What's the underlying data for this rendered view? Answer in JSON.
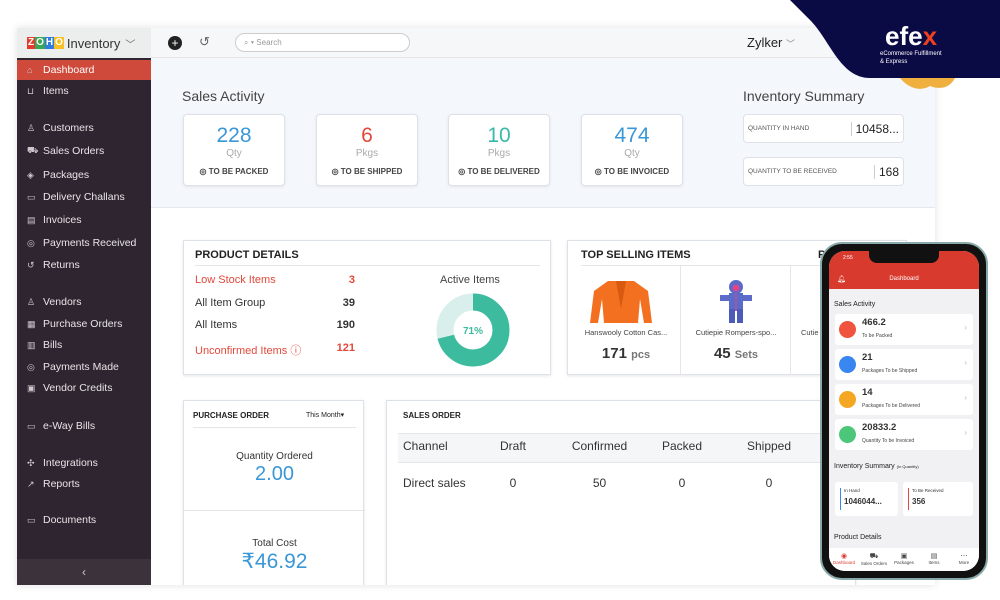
{
  "app": {
    "brand": "Inventory",
    "org": "Zylker",
    "search_placeholder": "Search"
  },
  "sidebar": {
    "items": [
      {
        "label": "Dashboard",
        "icon": "home-icon",
        "active": true
      },
      {
        "label": "Items",
        "icon": "basket-icon"
      },
      {
        "label": "Customers",
        "icon": "user-icon"
      },
      {
        "label": "Sales Orders",
        "icon": "cart-icon"
      },
      {
        "label": "Packages",
        "icon": "package-icon"
      },
      {
        "label": "Delivery Challans",
        "icon": "truck-icon"
      },
      {
        "label": "Invoices",
        "icon": "invoice-icon"
      },
      {
        "label": "Payments Received",
        "icon": "payment-icon"
      },
      {
        "label": "Returns",
        "icon": "return-icon"
      },
      {
        "label": "Vendors",
        "icon": "vendor-icon"
      },
      {
        "label": "Purchase Orders",
        "icon": "purchase-icon"
      },
      {
        "label": "Bills",
        "icon": "bill-icon"
      },
      {
        "label": "Payments Made",
        "icon": "payment-icon"
      },
      {
        "label": "Vendor Credits",
        "icon": "credit-icon"
      },
      {
        "label": "e-Way Bills",
        "icon": "eway-icon"
      },
      {
        "label": "Integrations",
        "icon": "integration-icon"
      },
      {
        "label": "Reports",
        "icon": "report-icon"
      },
      {
        "label": "Documents",
        "icon": "folder-icon"
      }
    ]
  },
  "sales_activity": {
    "title": "Sales Activity",
    "cards": [
      {
        "value": "228",
        "unit": "Qty",
        "label": "TO BE PACKED",
        "color": "#3a97d6"
      },
      {
        "value": "6",
        "unit": "Pkgs",
        "label": "TO BE SHIPPED",
        "color": "#e2493a"
      },
      {
        "value": "10",
        "unit": "Pkgs",
        "label": "TO BE DELIVERED",
        "color": "#3ab8a8"
      },
      {
        "value": "474",
        "unit": "Qty",
        "label": "TO BE INVOICED",
        "color": "#3a97d6"
      }
    ]
  },
  "inventory_summary": {
    "title": "Inventory Summary",
    "rows": [
      {
        "label": "QUANTITY IN HAND",
        "value": "10458..."
      },
      {
        "label": "QUANTITY TO BE RECEIVED",
        "value": "168"
      }
    ]
  },
  "product_details": {
    "title": "PRODUCT DETAILS",
    "rows": [
      {
        "label": "Low Stock Items",
        "value": "3",
        "alert": true
      },
      {
        "label": "All Item Group",
        "value": "39"
      },
      {
        "label": "All Items",
        "value": "190"
      },
      {
        "label": "Unconfirmed Items ⓘ",
        "value": "121",
        "alert": true
      }
    ],
    "active_items_label": "Active Items",
    "active_percent": 71,
    "active_percent_label": "71%"
  },
  "top_selling": {
    "title": "TOP SELLING ITEMS",
    "extra": "P",
    "items": [
      {
        "name": "Hanswooly Cotton Cas...",
        "qty": "171",
        "unit": "pcs"
      },
      {
        "name": "Cutiepie Rompers-spo...",
        "qty": "45",
        "unit": "Sets"
      },
      {
        "name": "Cutie"
      }
    ]
  },
  "purchase_order": {
    "title": "PURCHASE ORDER",
    "period": "This Month",
    "qty_label": "Quantity Ordered",
    "qty": "2.00",
    "cost_label": "Total Cost",
    "cost": "₹46.92"
  },
  "sales_order": {
    "title": "SALES ORDER",
    "columns": [
      "Channel",
      "Draft",
      "Confirmed",
      "Packed",
      "Shipped"
    ],
    "rows": [
      [
        "Direct sales",
        "0",
        "50",
        "0",
        "0"
      ]
    ]
  },
  "mobile": {
    "time": "2:55",
    "title": "Dashboard",
    "sales_title": "Sales Activity",
    "cards": [
      {
        "value": "466.2",
        "label": "To be Packed",
        "color": "#f0533e"
      },
      {
        "value": "21",
        "label": "Packages To be Shipped",
        "color": "#3a86f0"
      },
      {
        "value": "14",
        "label": "Packages To be Delivered",
        "color": "#f5a623"
      },
      {
        "value": "20833.2",
        "label": "Quantity To be Invoiced",
        "color": "#4cc77a"
      }
    ],
    "inv_title": "Inventory Summary",
    "inv_sub": "(In Quantity)",
    "in_hand_label": "In Hand",
    "in_hand": "1046044...",
    "receive_label": "To Be Received",
    "receive": "356",
    "product_title": "Product Details",
    "tabs": [
      "Dashboard",
      "Sales Orders",
      "Packages",
      "Items",
      "More"
    ]
  },
  "logo": {
    "name": "efex",
    "tagline1": "eCommerce Fulfillment",
    "tagline2": "& Express"
  }
}
